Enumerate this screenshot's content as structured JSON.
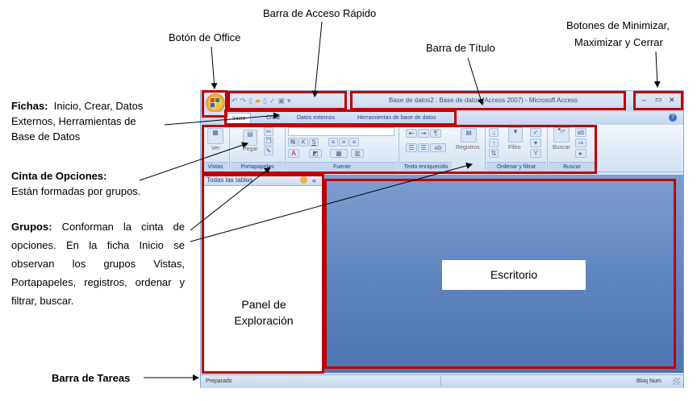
{
  "annotations": {
    "barra_acceso_rapido": "Barra de Acceso Rápido",
    "boton_office": "Botón de Office",
    "barra_titulo": "Barra de Título",
    "botones_ventana_1": "Botones de Minimizar,",
    "botones_ventana_2": "Maximizar y Cerrar",
    "fichas_bold": "Fichas:",
    "fichas_line1": "Inicio, Crear, Datos",
    "fichas_line2": "Externos, Herramientas de",
    "fichas_line3": "Base de Datos",
    "cinta_bold": "Cinta de Opciones:",
    "cinta_text": "Están formadas por grupos.",
    "grupos_bold": "Grupos:",
    "grupos_text": "Conforman la cinta de opciones. En la ficha Inicio se observan los grupos Vistas, Portapapeles, registros, ordenar y filtrar, buscar.",
    "barra_tareas": "Barra de Tareas",
    "escritorio": "Escritorio",
    "panel_1": "Panel de",
    "panel_2": "Exploración"
  },
  "window": {
    "title": "Base de datos2 : Base de datos (Access 2007) - Microsoft Access",
    "minimize": "–",
    "maximize": "▭",
    "close": "✕",
    "tabs": [
      "Inicio",
      "Crear",
      "Datos externos",
      "Herramientas de base de datos"
    ],
    "help": "?",
    "groups": [
      "Vistas",
      "Portapapeles",
      "Fuente",
      "Texto enriquecido",
      "Ordenar y filtrar",
      "Buscar"
    ],
    "ribbon_buttons": {
      "ver": "Ver",
      "pegar": "Pegar",
      "registros": "Registros",
      "filtro": "Filtro",
      "buscar": "Buscar"
    },
    "nav_title": "Todas las tablas",
    "nav_collapse": "«",
    "status_left": "Preparado",
    "status_right": "Bloq Num"
  },
  "colors": {
    "annotation_red": "#c00000",
    "ribbon_text": "#15428b",
    "desktop_blue": "#5d84bf"
  }
}
